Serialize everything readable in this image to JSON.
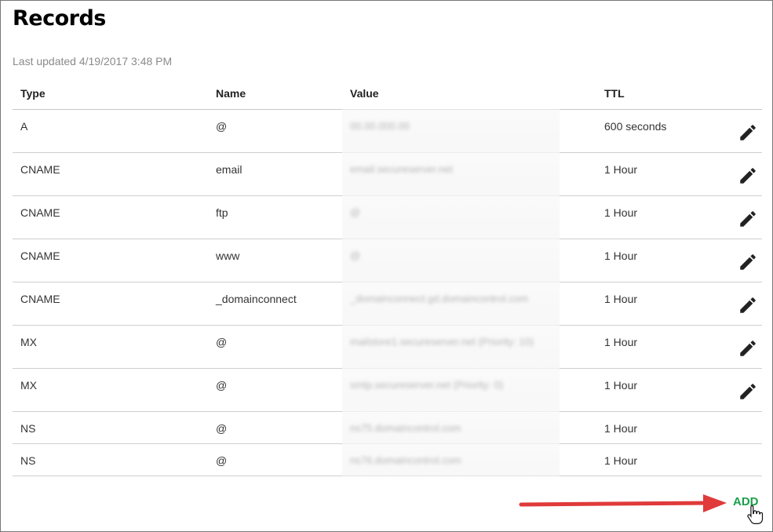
{
  "page": {
    "title": "Records",
    "last_updated": "Last updated 4/19/2017 3:48 PM"
  },
  "table": {
    "headers": {
      "type": "Type",
      "name": "Name",
      "value": "Value",
      "ttl": "TTL"
    },
    "rows": [
      {
        "type": "A",
        "name": "@",
        "value": "00.00.000.00",
        "ttl": "600 seconds",
        "editable": true
      },
      {
        "type": "CNAME",
        "name": "email",
        "value": "email.secureserver.net",
        "ttl": "1 Hour",
        "editable": true
      },
      {
        "type": "CNAME",
        "name": "ftp",
        "value": "@",
        "ttl": "1 Hour",
        "editable": true
      },
      {
        "type": "CNAME",
        "name": "www",
        "value": "@",
        "ttl": "1 Hour",
        "editable": true
      },
      {
        "type": "CNAME",
        "name": "_domainconnect",
        "value": "_domainconnect.gd.domaincontrol.com",
        "ttl": "1 Hour",
        "editable": true
      },
      {
        "type": "MX",
        "name": "@",
        "value": "mailstore1.secureserver.net (Priority: 10)",
        "ttl": "1 Hour",
        "editable": true
      },
      {
        "type": "MX",
        "name": "@",
        "value": "smtp.secureserver.net (Priority: 0)",
        "ttl": "1 Hour",
        "editable": true
      },
      {
        "type": "NS",
        "name": "@",
        "value": "ns75.domaincontrol.com",
        "ttl": "1 Hour",
        "editable": false
      },
      {
        "type": "NS",
        "name": "@",
        "value": "ns76.domaincontrol.com",
        "ttl": "1 Hour",
        "editable": false
      }
    ]
  },
  "actions": {
    "add_label": "ADD"
  },
  "icons": {
    "edit": "pencil-icon",
    "annotation": "red-arrow-icon",
    "cursor": "hand-pointer-icon"
  },
  "colors": {
    "add": "#1aa04a",
    "arrow": "#e03a3a",
    "icon": "#222222"
  }
}
